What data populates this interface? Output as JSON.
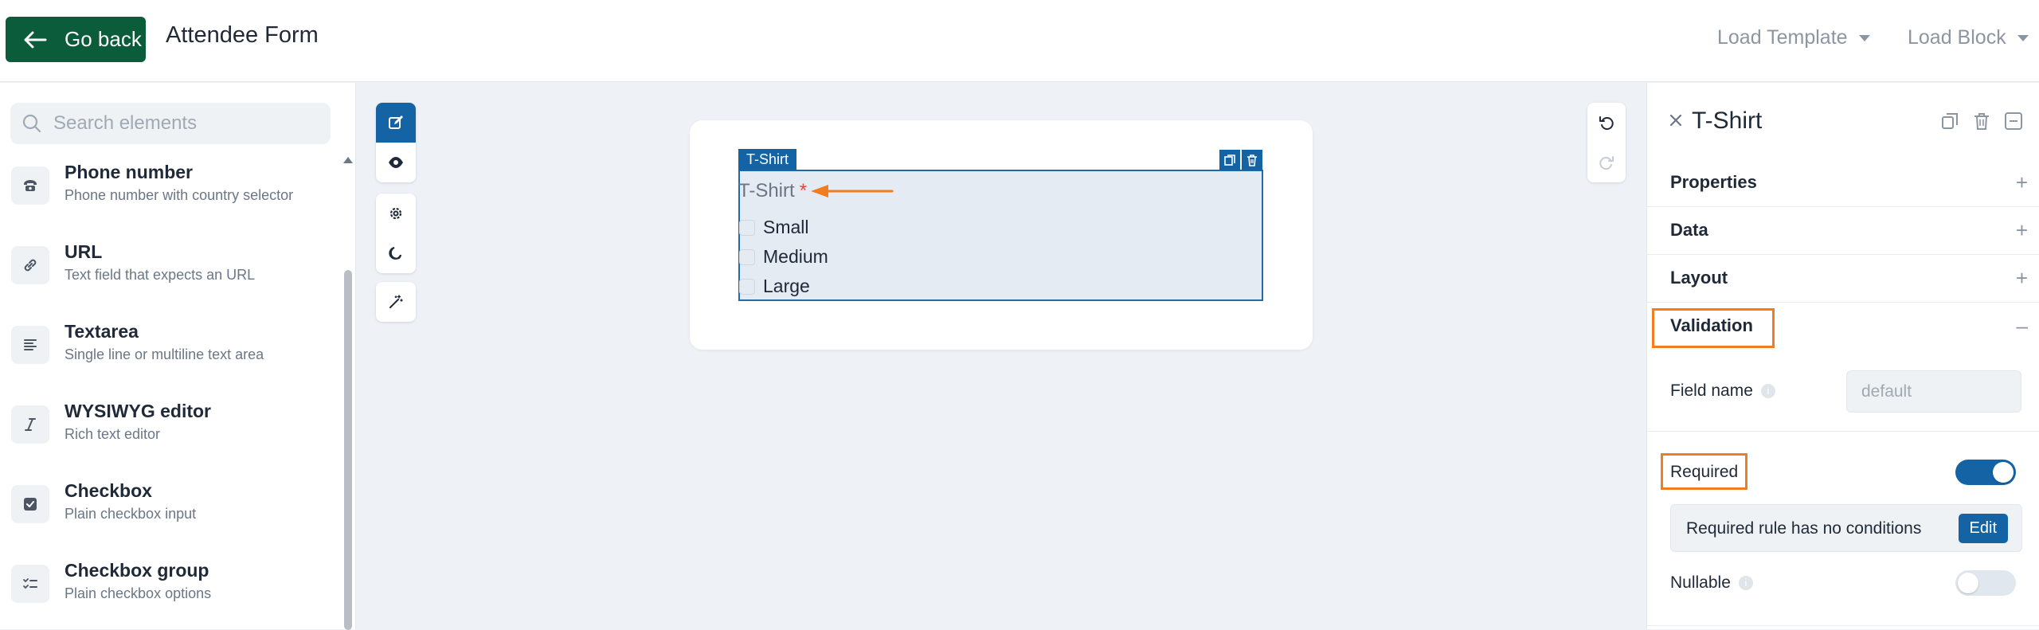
{
  "header": {
    "back_label": "Go back",
    "title": "Attendee Form",
    "load_template": "Load Template",
    "load_block": "Load Block"
  },
  "sidebar": {
    "search_placeholder": "Search elements",
    "items": [
      {
        "name": "Phone number",
        "desc": "Phone number with country selector",
        "icon": "phone-icon"
      },
      {
        "name": "URL",
        "desc": "Text field that expects an URL",
        "icon": "link-icon"
      },
      {
        "name": "Textarea",
        "desc": "Single line or multiline text area",
        "icon": "align-left-icon"
      },
      {
        "name": "WYSIWYG editor",
        "desc": "Rich text editor",
        "icon": "italic-icon"
      },
      {
        "name": "Checkbox",
        "desc": "Plain checkbox input",
        "icon": "checkbox-icon"
      },
      {
        "name": "Checkbox group",
        "desc": "Plain checkbox options",
        "icon": "list-check-icon"
      }
    ]
  },
  "canvas": {
    "field_tag": "T-Shirt",
    "field_label": "T-Shirt",
    "required_mark": "*",
    "options": [
      "Small",
      "Medium",
      "Large"
    ]
  },
  "panel": {
    "title": "T-Shirt",
    "sections": [
      "Properties",
      "Data",
      "Layout",
      "Validation"
    ],
    "field_name_label": "Field name",
    "field_name_placeholder": "default",
    "required_label": "Required",
    "required_on": true,
    "rule_text": "Required rule has no conditions",
    "edit_label": "Edit",
    "nullable_label": "Nullable",
    "nullable_on": false
  },
  "colors": {
    "primary": "#1464a5",
    "back_button": "#0a5c3a",
    "highlight": "#f07d22"
  }
}
